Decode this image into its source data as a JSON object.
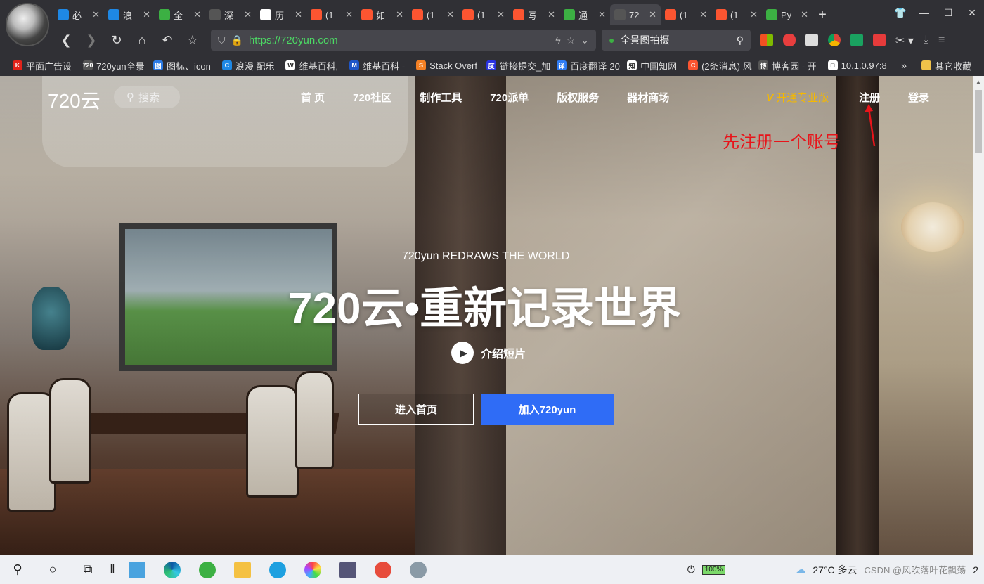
{
  "browser": {
    "tabs": [
      {
        "label": "必",
        "icon": "bing-icon",
        "color": "#1e88e5"
      },
      {
        "label": "浪",
        "icon": "langman-icon",
        "color": "#1e88e5"
      },
      {
        "label": "全",
        "icon": "360-icon",
        "color": "#3cb043"
      },
      {
        "label": "深",
        "icon": "shen-icon",
        "color": "#555"
      },
      {
        "label": "历",
        "icon": "history-icon",
        "color": "#fff"
      },
      {
        "label": "(1",
        "icon": "csdn-icon",
        "color": "#fc5531"
      },
      {
        "label": "如",
        "icon": "csdn-icon",
        "color": "#fc5531"
      },
      {
        "label": "(1",
        "icon": "csdn-icon",
        "color": "#fc5531"
      },
      {
        "label": "(1",
        "icon": "csdn-icon",
        "color": "#fc5531"
      },
      {
        "label": "写",
        "icon": "csdn-icon",
        "color": "#fc5531"
      },
      {
        "label": "通",
        "icon": "360-icon",
        "color": "#3cb043"
      },
      {
        "label": "72",
        "icon": "720yun-icon",
        "color": "#555"
      },
      {
        "label": "(1",
        "icon": "csdn-icon",
        "color": "#fc5531"
      },
      {
        "label": "(1",
        "icon": "csdn-icon",
        "color": "#fc5531"
      },
      {
        "label": "Py",
        "icon": "360-icon",
        "color": "#3cb043"
      }
    ],
    "active_tab_index": 11,
    "tab_close": "✕",
    "new_tab": "+",
    "url": "https://720yun.com",
    "search_text": "全景图拍摄",
    "bookmarks": [
      {
        "label": "平面广告设",
        "icon": "K",
        "color": "#e2231a"
      },
      {
        "label": "720yun全景",
        "icon": "720",
        "color": "#555"
      },
      {
        "label": "图标、icon",
        "icon": "图",
        "color": "#2c7be5"
      },
      {
        "label": "浪漫 配乐",
        "icon": "C",
        "color": "#1e88e5"
      },
      {
        "label": "维基百科,",
        "icon": "W",
        "color": "#fff"
      },
      {
        "label": "维基百科 -",
        "icon": "M",
        "color": "#1e56c8"
      },
      {
        "label": "Stack Overf",
        "icon": "S",
        "color": "#f48024"
      },
      {
        "label": "链接提交_加",
        "icon": "度",
        "color": "#2932e1"
      },
      {
        "label": "百度翻译-20",
        "icon": "译",
        "color": "#2f7cf6"
      },
      {
        "label": "中国知网",
        "icon": "知",
        "color": "#fff"
      },
      {
        "label": "(2条消息) 风",
        "icon": "C",
        "color": "#fc5531"
      },
      {
        "label": "博客园 - 开",
        "icon": "博",
        "color": "#555"
      },
      {
        "label": "10.1.0.97:8",
        "icon": "□",
        "color": "#fff"
      }
    ],
    "more": "»",
    "other_bookmarks": "其它收藏"
  },
  "site": {
    "logo": "720云",
    "search_label": "搜索",
    "menu": [
      "首 页",
      "720社区",
      "制作工具",
      "720派单",
      "版权服务",
      "器材商场"
    ],
    "pro": "开通专业版",
    "register": "注册",
    "login": "登录",
    "annotation": "先注册一个账号",
    "subtitle": "720yun REDRAWS THE WORLD",
    "title": "720云•重新记录世界",
    "video_label": "介绍短片",
    "btn_enter": "进入首页",
    "btn_join": "加入720yun"
  },
  "taskbar": {
    "weather": "27°C  多云",
    "battery": "100%",
    "watermark": "CSDN @风吹落叶花飘荡",
    "overflow": "2"
  }
}
